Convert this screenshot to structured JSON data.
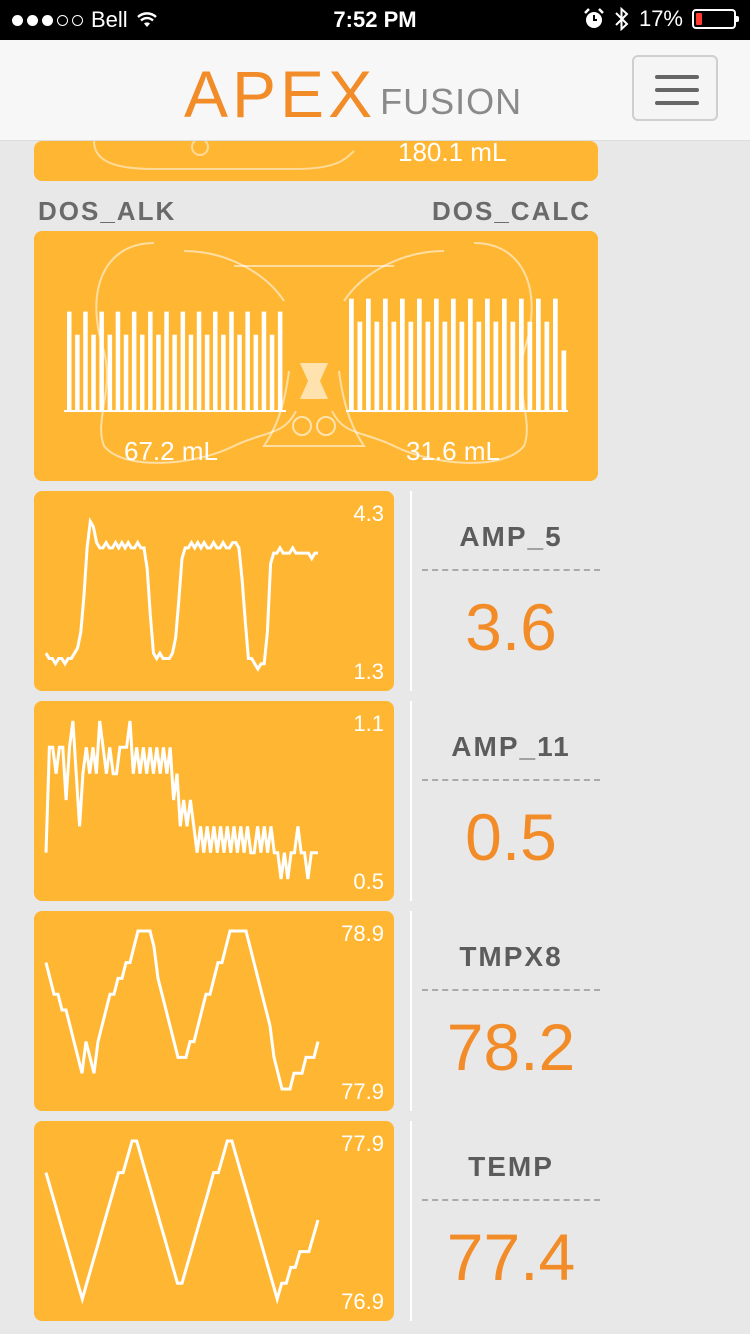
{
  "status": {
    "carrier": "Bell",
    "time": "7:52 PM",
    "battery": "17%",
    "battery_level": 0.17,
    "signal_bars": 3,
    "icons": [
      "wifi-icon",
      "alarm-icon",
      "bluetooth-icon",
      "battery-icon"
    ]
  },
  "header": {
    "logo_main": "APEX",
    "logo_sub": "FUSION",
    "menu_icon": "hamburger-icon"
  },
  "top_tile": {
    "volume": "180.1 mL"
  },
  "dosing": {
    "left_name": "DOS_ALK",
    "right_name": "DOS_CALC",
    "left_volume": "67.2 mL",
    "right_volume": "31.6 mL",
    "left_bars": [
      0.69,
      0.53,
      0.69,
      0.53,
      0.69,
      0.53,
      0.69,
      0.53,
      0.69,
      0.53,
      0.69,
      0.53,
      0.69,
      0.53,
      0.69,
      0.53,
      0.69,
      0.53,
      0.69,
      0.53,
      0.69,
      0.53,
      0.69,
      0.53,
      0.69,
      0.53,
      0.69
    ],
    "right_bars": [
      0.78,
      0.62,
      0.78,
      0.62,
      0.78,
      0.62,
      0.78,
      0.62,
      0.78,
      0.62,
      0.78,
      0.62,
      0.78,
      0.62,
      0.78,
      0.62,
      0.78,
      0.62,
      0.78,
      0.62,
      0.78,
      0.62,
      0.78,
      0.62,
      0.78,
      0.42
    ],
    "accent": "#ffb733"
  },
  "probes": [
    {
      "name": "AMP_5",
      "value": "3.6",
      "max": "4.3",
      "min": "1.3",
      "series": [
        1.6,
        1.5,
        1.5,
        1.4,
        1.5,
        1.5,
        1.4,
        1.5,
        1.5,
        1.6,
        1.7,
        2.0,
        2.7,
        3.6,
        4.1,
        4.0,
        3.7,
        3.6,
        3.6,
        3.7,
        3.6,
        3.6,
        3.7,
        3.6,
        3.7,
        3.6,
        3.7,
        3.6,
        3.6,
        3.7,
        3.6,
        3.6,
        3.2,
        2.3,
        1.6,
        1.5,
        1.6,
        1.5,
        1.5,
        1.5,
        1.6,
        1.9,
        2.6,
        3.4,
        3.6,
        3.6,
        3.7,
        3.6,
        3.7,
        3.6,
        3.7,
        3.6,
        3.6,
        3.7,
        3.6,
        3.6,
        3.7,
        3.6,
        3.6,
        3.7,
        3.7,
        3.6,
        3.0,
        2.2,
        1.5,
        1.5,
        1.4,
        1.3,
        1.4,
        1.4,
        2.0,
        3.3,
        3.5,
        3.5,
        3.6,
        3.5,
        3.5,
        3.5,
        3.6,
        3.5,
        3.5,
        3.5,
        3.5,
        3.5,
        3.4,
        3.5,
        3.5
      ]
    },
    {
      "name": "AMP_11",
      "value": "0.5",
      "max": "1.1",
      "min": "0.5",
      "series": [
        0.6,
        1.0,
        1.0,
        0.9,
        1.0,
        1.0,
        0.8,
        1.0,
        1.1,
        0.9,
        0.7,
        0.9,
        1.0,
        0.9,
        1.0,
        0.9,
        1.1,
        1.0,
        0.9,
        1.0,
        0.9,
        0.9,
        1.0,
        1.0,
        1.0,
        1.1,
        0.9,
        1.0,
        0.9,
        1.0,
        0.9,
        1.0,
        0.9,
        1.0,
        0.9,
        1.0,
        0.9,
        1.0,
        0.8,
        0.9,
        0.7,
        0.8,
        0.7,
        0.8,
        0.7,
        0.6,
        0.7,
        0.6,
        0.7,
        0.6,
        0.7,
        0.6,
        0.7,
        0.6,
        0.7,
        0.6,
        0.7,
        0.6,
        0.7,
        0.6,
        0.7,
        0.6,
        0.6,
        0.7,
        0.6,
        0.7,
        0.6,
        0.7,
        0.6,
        0.6,
        0.5,
        0.6,
        0.5,
        0.6,
        0.6,
        0.7,
        0.6,
        0.6,
        0.5,
        0.6,
        0.6,
        0.6
      ]
    },
    {
      "name": "TMPX8",
      "value": "78.2",
      "max": "78.9",
      "min": "77.9",
      "series": [
        78.7,
        78.6,
        78.5,
        78.5,
        78.4,
        78.4,
        78.3,
        78.2,
        78.1,
        78.0,
        78.2,
        78.1,
        78.0,
        78.2,
        78.3,
        78.4,
        78.5,
        78.5,
        78.6,
        78.6,
        78.7,
        78.7,
        78.8,
        78.9,
        78.9,
        78.9,
        78.9,
        78.8,
        78.6,
        78.5,
        78.4,
        78.3,
        78.2,
        78.1,
        78.1,
        78.1,
        78.2,
        78.2,
        78.3,
        78.4,
        78.5,
        78.5,
        78.6,
        78.7,
        78.7,
        78.8,
        78.9,
        78.9,
        78.9,
        78.9,
        78.9,
        78.8,
        78.7,
        78.6,
        78.5,
        78.4,
        78.3,
        78.1,
        78.0,
        77.9,
        77.9,
        77.9,
        78.0,
        78.0,
        78.0,
        78.1,
        78.1,
        78.1,
        78.2
      ]
    },
    {
      "name": "TEMP",
      "value": "77.4",
      "max": "77.9",
      "min": "76.9",
      "series": [
        77.7,
        77.6,
        77.5,
        77.4,
        77.3,
        77.2,
        77.1,
        77.0,
        76.9,
        77.0,
        77.1,
        77.2,
        77.3,
        77.4,
        77.5,
        77.6,
        77.7,
        77.7,
        77.8,
        77.9,
        77.9,
        77.8,
        77.7,
        77.6,
        77.5,
        77.4,
        77.3,
        77.2,
        77.1,
        77.0,
        77.0,
        77.1,
        77.2,
        77.3,
        77.4,
        77.5,
        77.6,
        77.7,
        77.7,
        77.8,
        77.9,
        77.9,
        77.8,
        77.7,
        77.6,
        77.5,
        77.4,
        77.3,
        77.2,
        77.1,
        77.0,
        76.9,
        77.0,
        77.0,
        77.1,
        77.1,
        77.2,
        77.2,
        77.2,
        77.3,
        77.4
      ]
    }
  ],
  "colors": {
    "tile": "#ffb733",
    "value": "#f28c28",
    "label": "#5c5c5c"
  }
}
